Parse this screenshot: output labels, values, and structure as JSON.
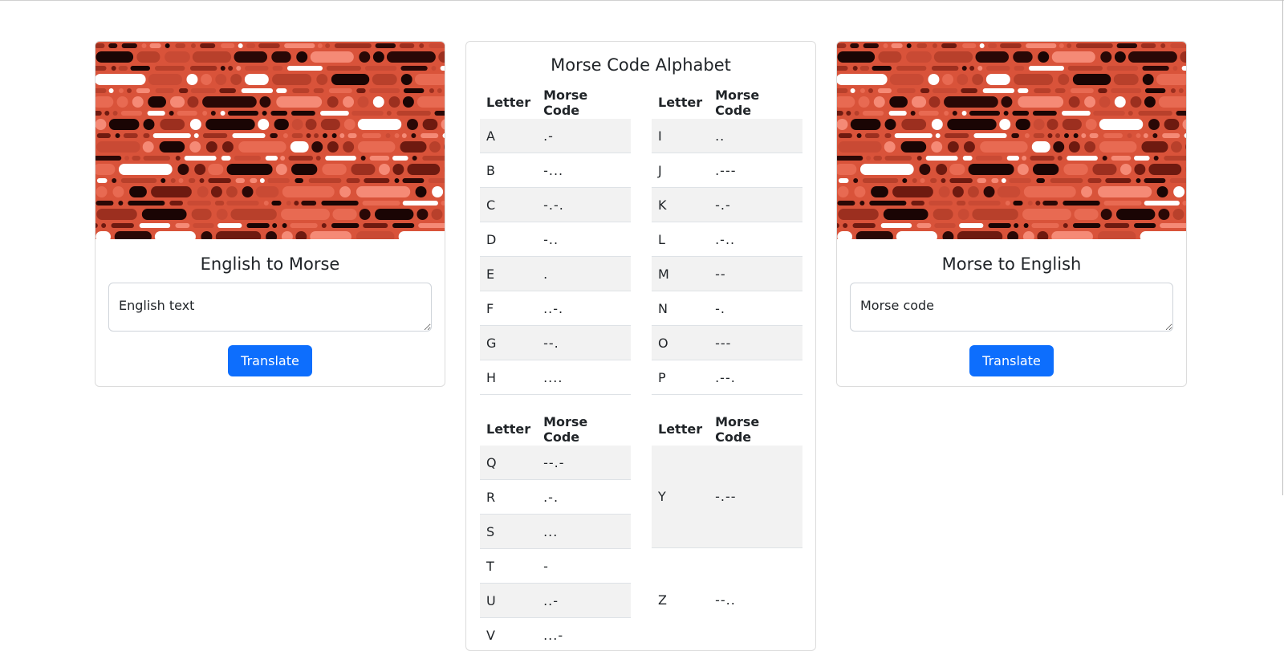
{
  "english_panel": {
    "title": "English to Morse",
    "input_placeholder": "English text",
    "button_label": "Translate"
  },
  "alphabet_panel": {
    "title": "Morse Code Alphabet",
    "header_letter": "Letter",
    "header_code": "Morse Code",
    "tables": [
      [
        [
          [
            "A",
            ".-"
          ],
          [
            "B",
            "-..."
          ],
          [
            "C",
            "-.-."
          ],
          [
            "D",
            "-.."
          ],
          [
            "E",
            "."
          ],
          [
            "F",
            "..-."
          ],
          [
            "G",
            "--."
          ],
          [
            "H",
            "...."
          ]
        ],
        [
          [
            "I",
            ".."
          ],
          [
            "J",
            ".---"
          ],
          [
            "K",
            "-.-"
          ],
          [
            "L",
            ".-.."
          ],
          [
            "M",
            "--"
          ],
          [
            "N",
            "-."
          ],
          [
            "O",
            "---"
          ],
          [
            "P",
            ".--."
          ]
        ]
      ],
      [
        [
          [
            "Q",
            "--.-"
          ],
          [
            "R",
            ".-."
          ],
          [
            "S",
            "..."
          ],
          [
            "T",
            "-"
          ],
          [
            "U",
            "..-"
          ],
          [
            "V",
            "...-"
          ]
        ],
        [
          [
            "Y",
            "-.--"
          ],
          [
            "Z",
            "--.."
          ]
        ]
      ]
    ]
  },
  "morse_panel": {
    "title": "Morse to English",
    "input_placeholder": "Morse code",
    "button_label": "Translate"
  },
  "colors": {
    "accent": "#0d6efd",
    "banner_bg": "#d9533a",
    "stripe": "#f2f2f2"
  }
}
